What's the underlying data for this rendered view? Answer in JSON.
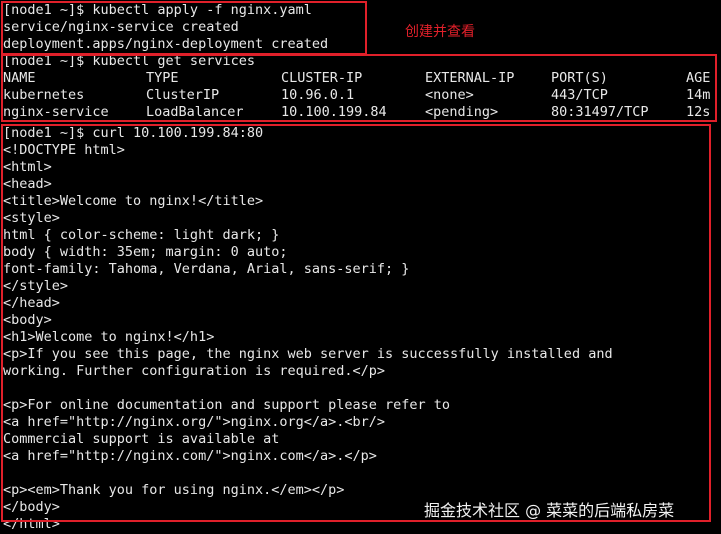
{
  "terminal": {
    "lines": [
      "[node1 ~]$ kubectl apply -f nginx.yaml",
      "service/nginx-service created",
      "deployment.apps/nginx-deployment created",
      "[node1 ~]$ kubectl get services"
    ],
    "table": {
      "headers": [
        "NAME",
        "TYPE",
        "CLUSTER-IP",
        "EXTERNAL-IP",
        "PORT(S)",
        "AGE"
      ],
      "rows": [
        [
          "kubernetes",
          "ClusterIP",
          "10.96.0.1",
          "<none>",
          "443/TCP",
          "14m"
        ],
        [
          "nginx-service",
          "LoadBalancer",
          "10.100.199.84",
          "<pending>",
          "80:31497/TCP",
          "12s"
        ]
      ]
    },
    "curl_lines": [
      "[node1 ~]$ curl 10.100.199.84:80",
      "<!DOCTYPE html>",
      "<html>",
      "<head>",
      "<title>Welcome to nginx!</title>",
      "<style>",
      "html { color-scheme: light dark; }",
      "body { width: 35em; margin: 0 auto;",
      "font-family: Tahoma, Verdana, Arial, sans-serif; }",
      "</style>",
      "</head>",
      "<body>",
      "<h1>Welcome to nginx!</h1>",
      "<p>If you see this page, the nginx web server is successfully installed and",
      "working. Further configuration is required.</p>",
      "",
      "<p>For online documentation and support please refer to",
      "<a href=\"http://nginx.org/\">nginx.org</a>.<br/>",
      "Commercial support is available at",
      "<a href=\"http://nginx.com/\">nginx.com</a>.</p>",
      "",
      "<p><em>Thank you for using nginx.</em></p>",
      "</body>",
      "</html>"
    ]
  },
  "annotation": "创建并查看",
  "watermark": "掘金技术社区 @ 菜菜的后端私房菜",
  "colors": {
    "background": "#000000",
    "text": "#e8e8e8",
    "highlight_box": "#e0202a"
  }
}
